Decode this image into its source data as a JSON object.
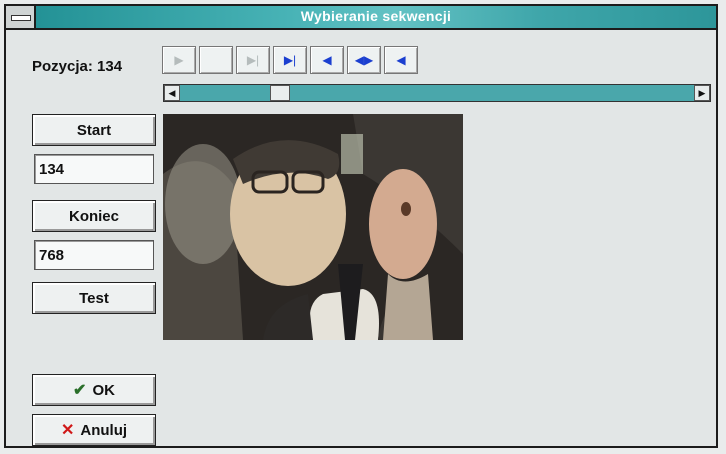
{
  "window": {
    "title": "Wybieranie sekwencji"
  },
  "position": {
    "label": "Pozycja: 134"
  },
  "toolbar": {
    "buttons": [
      {
        "icon": "play-icon",
        "glyph": "▶",
        "enabled": false
      },
      {
        "icon": "blank-icon",
        "glyph": "",
        "enabled": false
      },
      {
        "icon": "end-icon",
        "glyph": "▶|",
        "enabled": false
      },
      {
        "icon": "play-to-end-icon",
        "glyph": "▶|",
        "enabled": true
      },
      {
        "icon": "step-back-icon",
        "glyph": "◀",
        "enabled": true
      },
      {
        "icon": "step-icon",
        "glyph": "◀▶",
        "enabled": true
      },
      {
        "icon": "back-icon",
        "glyph": "◀",
        "enabled": true
      }
    ]
  },
  "controls": {
    "start_label": "Start",
    "start_value": "134",
    "end_label": "Koniec",
    "end_value": "768",
    "test_label": "Test",
    "ok_label": "OK",
    "cancel_label": "Anuluj"
  },
  "colors": {
    "title_bar": "#3fa6aa",
    "scrollbar": "#4aa7ab",
    "window_bg": "#e2e6e6"
  }
}
